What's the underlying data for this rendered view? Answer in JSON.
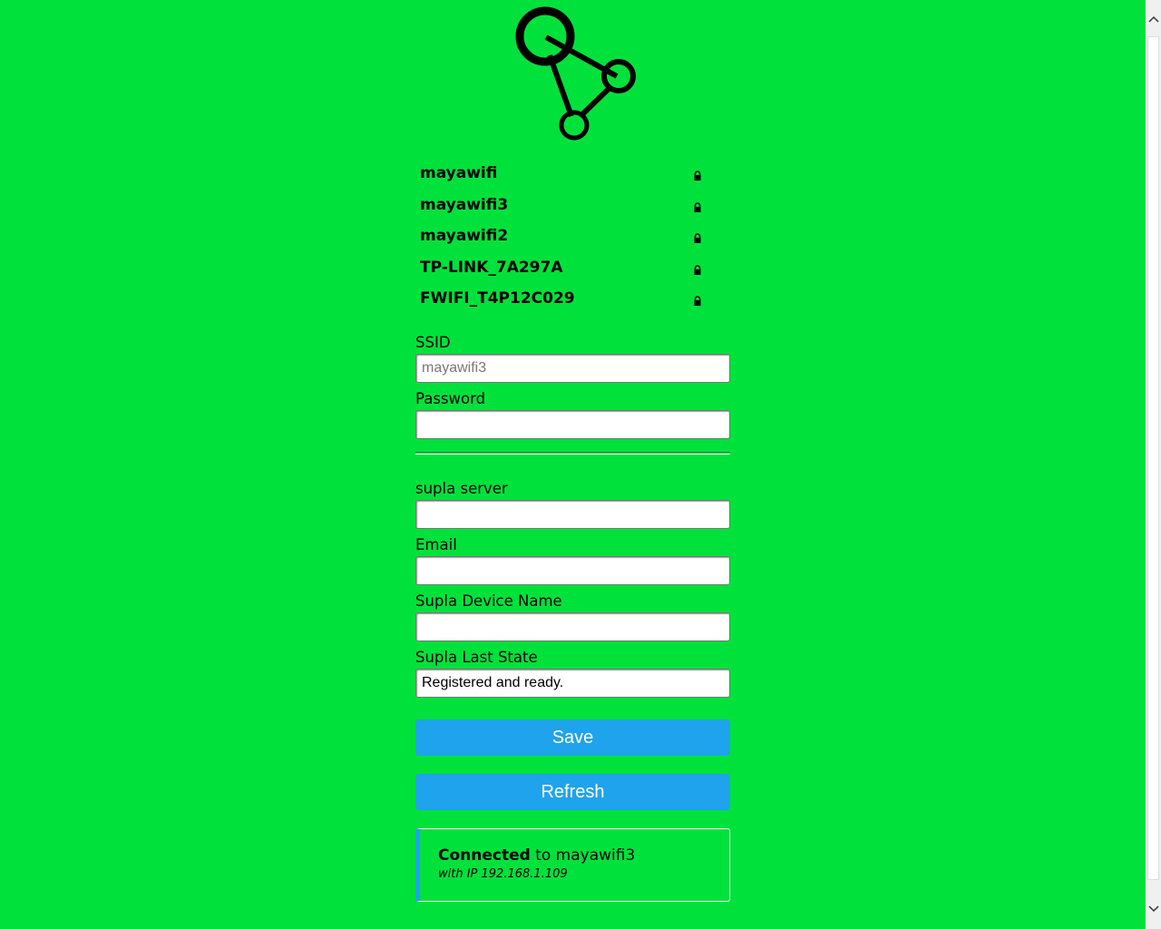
{
  "logo": {
    "icon": "network-nodes-icon"
  },
  "wifi_networks": [
    {
      "ssid": "mayawifi",
      "icon": "lock-icon"
    },
    {
      "ssid": "mayawifi3",
      "icon": "lock-icon"
    },
    {
      "ssid": "mayawifi2",
      "icon": "lock-icon"
    },
    {
      "ssid": "TP-LINK_7A297A",
      "icon": "lock-icon"
    },
    {
      "ssid": "FWIFI_T4P12C029",
      "icon": "lock-icon"
    }
  ],
  "form": {
    "ssid_label": "SSID",
    "ssid_placeholder": "mayawifi3",
    "ssid_value": "",
    "password_label": "Password",
    "password_value": "",
    "server_label": "supla server",
    "server_value": "",
    "email_label": "Email",
    "email_value": "",
    "device_name_label": "Supla Device Name",
    "device_name_value": "",
    "last_state_label": "Supla Last State",
    "last_state_value": "Registered and ready."
  },
  "buttons": {
    "save_label": "Save",
    "refresh_label": "Refresh"
  },
  "status": {
    "connected_word": "Connected",
    "connected_rest": " to mayawifi3",
    "ip_text": "with IP 192.168.1.109"
  },
  "colors": {
    "background": "#00e23b",
    "button": "#1fa3ec"
  }
}
